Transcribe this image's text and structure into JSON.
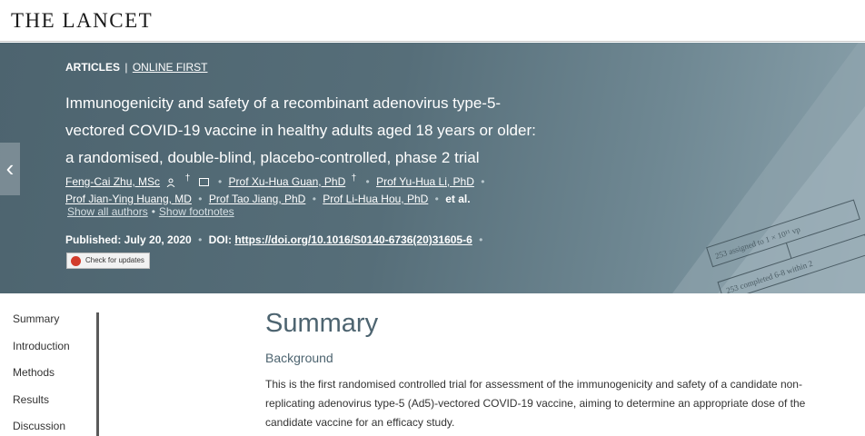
{
  "header": {
    "logo": "THE LANCET"
  },
  "article": {
    "type": "ARTICLES",
    "type_separator": "|",
    "status": "ONLINE FIRST",
    "title": "Immunogenicity and safety of a recombinant adenovirus type-5-vectored COVID-19 vaccine in healthy adults aged 18 years or older: a randomised, double-blind, placebo-controlled, phase 2 trial",
    "authors": [
      "Feng-Cai Zhu, MSc",
      "Prof Xu-Hua Guan, PhD",
      "Prof Yu-Hua Li, PhD",
      "Prof Jian-Ying Huang, MD",
      "Prof Tao Jiang, PhD",
      "Prof Li-Hua Hou, PhD"
    ],
    "dagger": "†",
    "et_al": "et al.",
    "show_authors": "Show all authors",
    "show_footnotes": "Show footnotes",
    "published_label": "Published: July 20, 2020",
    "doi_label": "DOI:",
    "doi": "https://doi.org/10.1016/S0140-6736(20)31605-6",
    "check_updates": "Check for updates"
  },
  "decoration": {
    "box1": "253 assigned to 1 × 10¹¹ vp",
    "box2": "253 completed 6-8 within 2"
  },
  "toc": [
    "Summary",
    "Introduction",
    "Methods",
    "Results",
    "Discussion"
  ],
  "content": {
    "section_title": "Summary",
    "sub_title": "Background",
    "paragraph": "This is the first randomised controlled trial for assessment of the immunogenicity and safety of a candidate non-replicating adenovirus type-5 (Ad5)-vectored COVID-19 vaccine, aiming to determine an appropriate dose of the candidate vaccine for an efficacy study."
  },
  "icons": {
    "prev": "chevron-left-icon",
    "person": "person-icon",
    "mail": "mail-icon",
    "crossmark": "crossmark-icon"
  }
}
